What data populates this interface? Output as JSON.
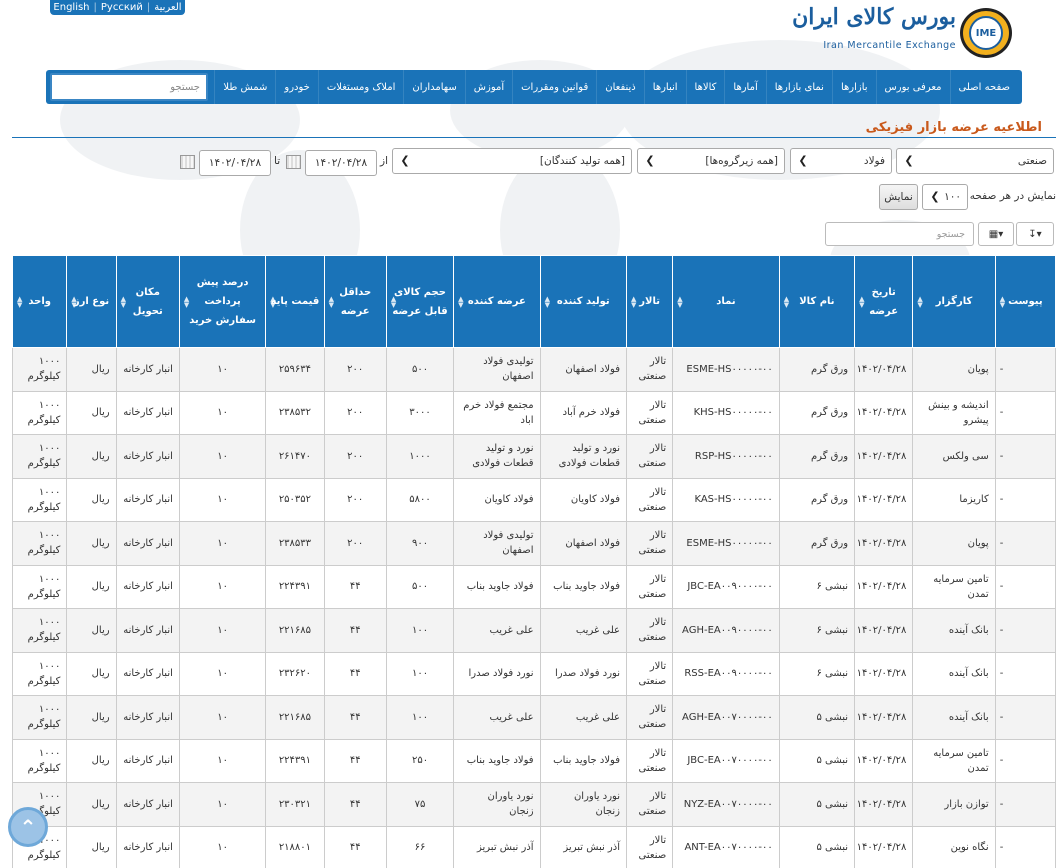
{
  "languages": [
    "English",
    "Pyccкий",
    "العربية"
  ],
  "logo": {
    "fa": "بورس کالای ایران",
    "en": "Iran Mercantile Exchange",
    "mark": "IME"
  },
  "nav": {
    "items": [
      "صفحه اصلی",
      "معرفی بورس",
      "بازارها",
      "نمای بازارها",
      "آمارها",
      "کالاها",
      "انبارها",
      "ذینفعان",
      "قوانین ومقررات",
      "آموزش",
      "سهامداران",
      "املاک ومستغلات",
      "خودرو",
      "شمش طلا"
    ],
    "search_placeholder": "جستجو"
  },
  "page_title": "اطلاعیه عرضه بازار فیزیکی",
  "filters": {
    "market": "صنعتی",
    "group": "فولاد",
    "subgroup": "[همه زیرگروه‌ها]",
    "producer": "[همه تولید کنندگان]",
    "from_label": "از",
    "from_date": "۱۴۰۲/۰۴/۲۸",
    "to_label": "تا",
    "to_date": "۱۴۰۲/۰۴/۲۸"
  },
  "paging": {
    "label": "نمایش در هر صفحه",
    "per_page": "۱۰۰",
    "show_button": "نمایش"
  },
  "table_search_placeholder": "جستجو",
  "columns": [
    "پیوست",
    "کارگزار",
    "تاریخ عرضه",
    "نام کالا",
    "نماد",
    "تالار",
    "تولید کننده",
    "عرضه کننده",
    "حجم کالای قابل عرضه",
    "حداقل عرضه",
    "قیمت پایه",
    "درصد پیش پرداخت سفارش خرید",
    "مکان تحویل",
    "نوع ارز",
    "واحد"
  ],
  "rows": [
    [
      "-",
      "پویان",
      "۱۴۰۲/۰۴/۲۸",
      "ورق گرم",
      "ESME-HS۰۰۰۰۰-۰۰",
      "تالار صنعتی",
      "فولاد اصفهان",
      "تولیدی فولاد اصفهان",
      "۵۰۰",
      "۲۰۰",
      "۲۵۹۶۳۴",
      "۱۰",
      "انبار کارخانه",
      "ریال",
      "۱۰۰۰ کیلوگرم"
    ],
    [
      "-",
      "اندیشه و بینش پیشرو",
      "۱۴۰۲/۰۴/۲۸",
      "ورق گرم",
      "KHS-HS۰۰۰۰۰-۰۰",
      "تالار صنعتی",
      "فولاد خرم آباد",
      "مجتمع فولاد خرم اباد",
      "۳۰۰۰",
      "۲۰۰",
      "۲۳۸۵۳۲",
      "۱۰",
      "انبار کارخانه",
      "ریال",
      "۱۰۰۰ کیلوگرم"
    ],
    [
      "-",
      "سی ولکس",
      "۱۴۰۲/۰۴/۲۸",
      "ورق گرم",
      "RSP-HS۰۰۰۰۰-۰۰",
      "تالار صنعتی",
      "نورد و تولید قطعات فولادی",
      "نورد و تولید قطعات فولادی",
      "۱۰۰۰",
      "۲۰۰",
      "۲۶۱۴۷۰",
      "۱۰",
      "انبار کارخانه",
      "ریال",
      "۱۰۰۰ کیلوگرم"
    ],
    [
      "-",
      "کاریزما",
      "۱۴۰۲/۰۴/۲۸",
      "ورق گرم",
      "KAS-HS۰۰۰۰۰-۰۰",
      "تالار صنعتی",
      "فولاد کاویان",
      "فولاد کاویان",
      "۵۸۰۰",
      "۲۰۰",
      "۲۵۰۳۵۲",
      "۱۰",
      "انبار کارخانه",
      "ریال",
      "۱۰۰۰ کیلوگرم"
    ],
    [
      "-",
      "پویان",
      "۱۴۰۲/۰۴/۲۸",
      "ورق گرم",
      "ESME-HS۰۰۰۰۰-۰۰",
      "تالار صنعتی",
      "فولاد اصفهان",
      "تولیدی فولاد اصفهان",
      "۹۰۰",
      "۲۰۰",
      "۲۳۸۵۳۳",
      "۱۰",
      "انبار کارخانه",
      "ریال",
      "۱۰۰۰ کیلوگرم"
    ],
    [
      "-",
      "تامین سرمایه تمدن",
      "۱۴۰۲/۰۴/۲۸",
      "نبشی ۶",
      "JBC-EA۰۰۹۰۰۰۰-۰۰",
      "تالار صنعتی",
      "فولاد جاوید بناب",
      "فولاد جاوید بناب",
      "۵۰۰",
      "۴۴",
      "۲۲۴۳۹۱",
      "۱۰",
      "انبار کارخانه",
      "ریال",
      "۱۰۰۰ کیلوگرم"
    ],
    [
      "-",
      "بانک آینده",
      "۱۴۰۲/۰۴/۲۸",
      "نبشی ۶",
      "AGH-EA۰۰۹۰۰۰۰-۰۰",
      "تالار صنعتی",
      "علی غریب",
      "علی غریب",
      "۱۰۰",
      "۴۴",
      "۲۲۱۶۸۵",
      "۱۰",
      "انبار کارخانه",
      "ریال",
      "۱۰۰۰ کیلوگرم"
    ],
    [
      "-",
      "بانک آینده",
      "۱۴۰۲/۰۴/۲۸",
      "نبشی ۶",
      "RSS-EA۰۰۹۰۰۰۰-۰۰",
      "تالار صنعتی",
      "نورد فولاد صدرا",
      "نورد فولاد صدرا",
      "۱۰۰",
      "۴۴",
      "۲۳۲۶۲۰",
      "۱۰",
      "انبار کارخانه",
      "ریال",
      "۱۰۰۰ کیلوگرم"
    ],
    [
      "-",
      "بانک آینده",
      "۱۴۰۲/۰۴/۲۸",
      "نبشی ۵",
      "AGH-EA۰۰۷۰۰۰۰-۰۰",
      "تالار صنعتی",
      "علی غریب",
      "علی غریب",
      "۱۰۰",
      "۴۴",
      "۲۲۱۶۸۵",
      "۱۰",
      "انبار کارخانه",
      "ریال",
      "۱۰۰۰ کیلوگرم"
    ],
    [
      "-",
      "تامین سرمایه تمدن",
      "۱۴۰۲/۰۴/۲۸",
      "نبشی ۵",
      "JBC-EA۰۰۷۰۰۰۰-۰۰",
      "تالار صنعتی",
      "فولاد جاوید بناب",
      "فولاد جاوید بناب",
      "۲۵۰",
      "۴۴",
      "۲۲۴۳۹۱",
      "۱۰",
      "انبار کارخانه",
      "ریال",
      "۱۰۰۰ کیلوگرم"
    ],
    [
      "-",
      "توازن بازار",
      "۱۴۰۲/۰۴/۲۸",
      "نبشی ۵",
      "NYZ-EA۰۰۷۰۰۰۰-۰۰",
      "تالار صنعتی",
      "نورد یاوران زنجان",
      "نورد یاوران زنجان",
      "۷۵",
      "۴۴",
      "۲۳۰۳۲۱",
      "۱۰",
      "انبار کارخانه",
      "ریال",
      "۱۰۰۰ کیلوگرم"
    ],
    [
      "-",
      "نگاه نوین",
      "۱۴۰۲/۰۴/۲۸",
      "نبشی ۵",
      "ANT-EA۰۰۷۰۰۰۰-۰۰",
      "تالار صنعتی",
      "آذر نبش تبریز",
      "آذر نبش تبریز",
      "۶۶",
      "۴۴",
      "۲۱۸۸۰۱",
      "۱۰",
      "انبار کارخانه",
      "ریال",
      "۱۰۰۰ کیلوگرم"
    ]
  ]
}
